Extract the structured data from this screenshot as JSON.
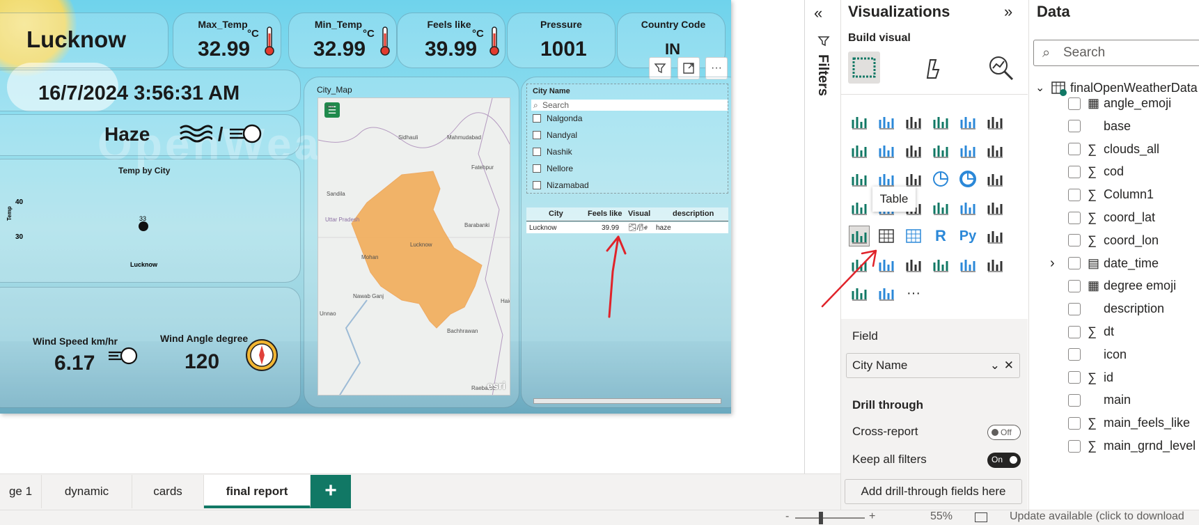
{
  "report": {
    "city": "Lucknow",
    "kpis": [
      {
        "label": "Max_Temp",
        "value": "32.99",
        "unit": "°C"
      },
      {
        "label": "Min_Temp",
        "value": "32.99",
        "unit": "°C"
      },
      {
        "label": "Feels like",
        "value": "39.99",
        "unit": "°C"
      },
      {
        "label": "Pressure",
        "value": "1001"
      },
      {
        "label": "Country Code",
        "value": "IN"
      }
    ],
    "datetime": "16/7/2024 3:56:31 AM",
    "weather": "Haze",
    "weather_sep": "/",
    "chart_title": "Temp by City",
    "chart_ylabel": "Temp",
    "chart_point_label": "33",
    "wind_speed_label": "Wind Speed km/hr",
    "wind_speed": "6.17",
    "wind_angle_label": "Wind Angle degree",
    "wind_angle": "120",
    "map_title": "City_Map",
    "map_labels": [
      "Mahmudabad",
      "Sidhauli",
      "Fatehpur",
      "Sandila",
      "Barabanki",
      "Uttar Pradesh",
      "Lucknow",
      "Mohan",
      "Nawab Ganj",
      "Unnao",
      "Bachhrawan",
      "Haid",
      "Raebareli",
      "khi"
    ],
    "map_attribution": "esri",
    "slicer": {
      "title": "City Name",
      "search_placeholder": "Search",
      "items": [
        "Nalgonda",
        "Nandyal",
        "Nashik",
        "Nellore",
        "Nizamabad"
      ]
    },
    "table": {
      "headers": [
        "City",
        "Feels like",
        "Visual",
        "description"
      ],
      "rows": [
        [
          "Lucknow",
          "39.99",
          "🌫/🌬",
          "haze"
        ]
      ]
    }
  },
  "chart_data": {
    "type": "scatter",
    "title": "Temp by City",
    "xlabel": "",
    "ylabel": "Temp",
    "categories": [
      "Lucknow"
    ],
    "values": [
      33
    ],
    "y_ticks": [
      30,
      40
    ],
    "grid": false
  },
  "filters_label": "Filters",
  "visualizations": {
    "title": "Visualizations",
    "build_visual": "Build visual",
    "tooltip": "Table",
    "field_section": "Field",
    "field_value": "City Name",
    "drill_through": "Drill through",
    "cross_report": "Cross-report",
    "cross_report_state": "Off",
    "keep_filters": "Keep all filters",
    "keep_filters_state": "On",
    "add_drill": "Add drill-through fields here",
    "more": "···"
  },
  "data_pane": {
    "title": "Data",
    "search_placeholder": "Search",
    "table_name": "finalOpenWeatherData",
    "fields": [
      {
        "name": "angle_emoji",
        "kind": "calc"
      },
      {
        "name": "base",
        "kind": "text"
      },
      {
        "name": "clouds_all",
        "kind": "sum"
      },
      {
        "name": "cod",
        "kind": "sum"
      },
      {
        "name": "Column1",
        "kind": "sum"
      },
      {
        "name": "coord_lat",
        "kind": "sum"
      },
      {
        "name": "coord_lon",
        "kind": "sum"
      },
      {
        "name": "date_time",
        "kind": "date"
      },
      {
        "name": "degree emoji",
        "kind": "calc"
      },
      {
        "name": "description",
        "kind": "text"
      },
      {
        "name": "dt",
        "kind": "sum"
      },
      {
        "name": "icon",
        "kind": "text"
      },
      {
        "name": "id",
        "kind": "sum"
      },
      {
        "name": "main",
        "kind": "text"
      },
      {
        "name": "main_feels_like",
        "kind": "sum"
      },
      {
        "name": "main_grnd_level",
        "kind": "sum"
      }
    ]
  },
  "tabs": [
    "ge 1",
    "dynamic",
    "cards",
    "final report"
  ],
  "status": {
    "zoom": "55%",
    "update": "Update available (click to download"
  }
}
